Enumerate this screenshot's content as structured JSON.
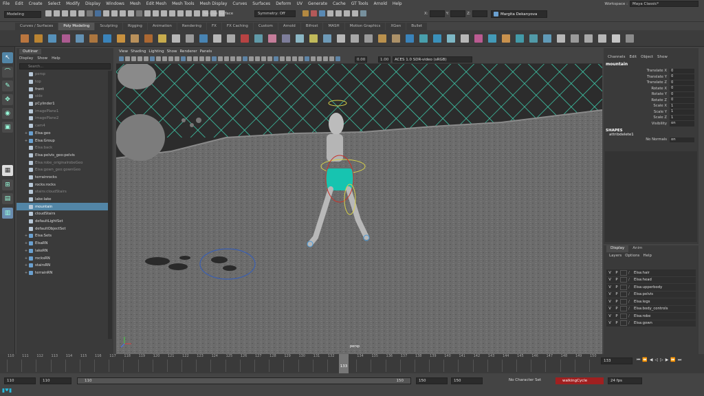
{
  "menus": [
    "File",
    "Edit",
    "Create",
    "Select",
    "Modify",
    "Display",
    "Windows",
    "Mesh",
    "Edit Mesh",
    "Mesh Tools",
    "Mesh Display",
    "Curves",
    "Surfaces",
    "Deform",
    "UV",
    "Generate",
    "Cache",
    "GT Tools",
    "Arnold",
    "Help"
  ],
  "workspace": {
    "label": "Workspace :",
    "value": "Maya Classic*"
  },
  "status": {
    "mode": "Modeling",
    "live_surface": "No Live Surface",
    "symmetry": "Symmetry: Off",
    "x_label": "X:",
    "y_label": "Y:",
    "z_label": "Z:",
    "user": "Margita Dekanyova"
  },
  "shelf_tabs": [
    "Curves / Surfaces",
    "Poly Modeling",
    "Sculpting",
    "Rigging",
    "Animation",
    "Rendering",
    "FX",
    "FX Caching",
    "Custom",
    "Arnold",
    "Bifrost",
    "MASH",
    "Motion Graphics",
    "XGen",
    "Bullet"
  ],
  "shelf_active": "Poly Modeling",
  "outliner": {
    "tab": "Outliner",
    "menu": [
      "Display",
      "Show",
      "Help"
    ],
    "search": "Search...",
    "items": [
      {
        "label": "persp",
        "dim": true,
        "exp": ""
      },
      {
        "label": "top",
        "dim": true,
        "exp": ""
      },
      {
        "label": "front",
        "dim": false,
        "exp": ""
      },
      {
        "label": "side",
        "dim": true,
        "exp": ""
      },
      {
        "label": "pCylinder1",
        "dim": false,
        "exp": ""
      },
      {
        "label": "imagePlane1",
        "dim": true,
        "exp": ""
      },
      {
        "label": "imagePlane2",
        "dim": true,
        "exp": ""
      },
      {
        "label": "cam4",
        "dim": true,
        "exp": ""
      },
      {
        "label": "Elsa:geo",
        "dim": false,
        "exp": "+"
      },
      {
        "label": "Elsa:Group",
        "dim": false,
        "exp": "+"
      },
      {
        "label": "Elsa:back",
        "dim": true,
        "exp": ""
      },
      {
        "label": "Elsa:pelvis_geo:pelvis",
        "dim": false,
        "exp": ""
      },
      {
        "label": "Elsa:robe_originalrobeGeo",
        "dim": true,
        "exp": ""
      },
      {
        "label": "Elsa:gown_geo:gownGeo",
        "dim": true,
        "exp": ""
      },
      {
        "label": "terrainrocks",
        "dim": false,
        "exp": ""
      },
      {
        "label": "rocks:rocks",
        "dim": false,
        "exp": ""
      },
      {
        "label": "stairs:cloudStairs",
        "dim": true,
        "exp": ""
      },
      {
        "label": "lake:lake",
        "dim": false,
        "exp": ""
      },
      {
        "label": "mountain",
        "dim": false,
        "exp": "",
        "sel": true
      },
      {
        "label": "cloudStairs",
        "dim": false,
        "exp": ""
      },
      {
        "label": "defaultLightSet",
        "dim": false,
        "exp": ""
      },
      {
        "label": "defaultObjectSet",
        "dim": false,
        "exp": ""
      },
      {
        "label": "Elsa:Sets",
        "dim": false,
        "exp": "+"
      },
      {
        "label": "ElsaRN",
        "dim": false,
        "exp": "+"
      },
      {
        "label": "lakeRN",
        "dim": false,
        "exp": "+"
      },
      {
        "label": "rocksRN",
        "dim": false,
        "exp": "+"
      },
      {
        "label": "stairsRN",
        "dim": false,
        "exp": "+"
      },
      {
        "label": "terrainRN",
        "dim": false,
        "exp": "+"
      }
    ]
  },
  "viewport": {
    "menu": [
      "View",
      "Shading",
      "Lighting",
      "Show",
      "Renderer",
      "Panels"
    ],
    "field1": "0.00",
    "field2": "1.00",
    "colorspace": "ACES 1.0 SDR-video (sRGB)",
    "camera_label": "persp"
  },
  "channels": {
    "menu": [
      "Channels",
      "Edit",
      "Object",
      "Show"
    ],
    "object": "mountain",
    "attrs": [
      {
        "label": "Translate X",
        "value": "0"
      },
      {
        "label": "Translate Y",
        "value": "0"
      },
      {
        "label": "Translate Z",
        "value": "0"
      },
      {
        "label": "Rotate X",
        "value": "0"
      },
      {
        "label": "Rotate Y",
        "value": "0"
      },
      {
        "label": "Rotate Z",
        "value": "0"
      },
      {
        "label": "Scale X",
        "value": "1"
      },
      {
        "label": "Scale Y",
        "value": "1"
      },
      {
        "label": "Scale Z",
        "value": "1"
      },
      {
        "label": "Visibility",
        "value": "on"
      }
    ],
    "shapes_header": "SHAPES",
    "shape_name": "attribdelete1",
    "no_normals_label": "No Normals",
    "no_normals_value": "on"
  },
  "layers": {
    "tabs": [
      "Display",
      "Anim"
    ],
    "menu": [
      "Layers",
      "Options",
      "Help"
    ],
    "items": [
      {
        "v": "V",
        "p": "P",
        "name": "Elsa:hair"
      },
      {
        "v": "V",
        "p": "P",
        "name": "Elsa:head"
      },
      {
        "v": "V",
        "p": "P",
        "name": "Elsa:upperbody"
      },
      {
        "v": "V",
        "p": "P",
        "name": "Elsa:pelvis"
      },
      {
        "v": "V",
        "p": "P",
        "name": "Elsa:legs"
      },
      {
        "v": "V",
        "p": "P",
        "name": "Elsa:body_controls"
      },
      {
        "v": "V",
        "p": "P",
        "name": "Elsa:robe"
      },
      {
        "v": "V",
        "p": "P",
        "name": "Elsa:gown"
      }
    ]
  },
  "timeline": {
    "start": 110,
    "end": 150,
    "current": "133",
    "ticks": [
      "110",
      "111",
      "112",
      "113",
      "114",
      "115",
      "116",
      "117",
      "118",
      "119",
      "120",
      "121",
      "122",
      "123",
      "124",
      "125",
      "126",
      "127",
      "128",
      "129",
      "130",
      "131",
      "132",
      "133",
      "134",
      "135",
      "136",
      "137",
      "138",
      "139",
      "140",
      "141",
      "142",
      "143",
      "144",
      "145",
      "146",
      "147",
      "148",
      "149",
      "150"
    ],
    "current_field": "133"
  },
  "range": {
    "start": "110",
    "anim_start": "110",
    "slider_start": "110",
    "slider_end": "150",
    "end": "150",
    "anim_end": "150",
    "character_set": "No Character Set",
    "anim_layer": "walkingCycle",
    "fps": "24 fps"
  },
  "colors": {
    "accent": "#5285a6",
    "grid": "#3fd6b4"
  }
}
